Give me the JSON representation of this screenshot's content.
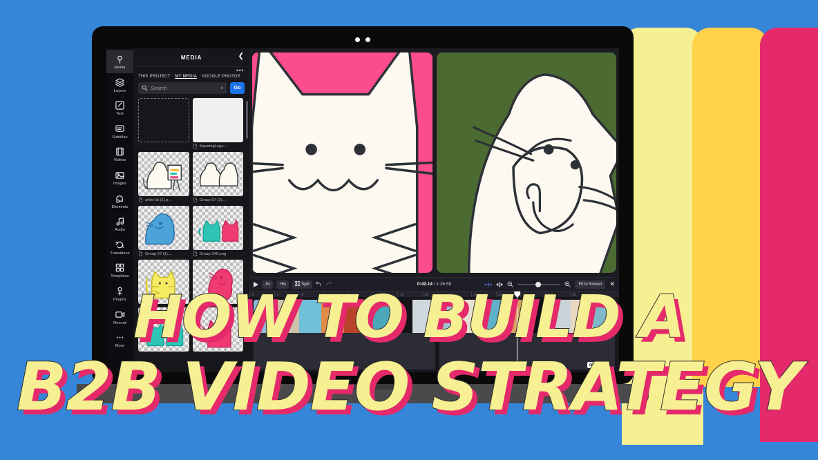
{
  "background": {
    "base_color": "#3585d8",
    "bars": [
      {
        "name": "bar-yellow-light",
        "color": "#f6f093"
      },
      {
        "name": "bar-yellow-gold",
        "color": "#ffd24a"
      },
      {
        "name": "bar-pink",
        "color": "#e42a6b"
      }
    ]
  },
  "overlay_title": {
    "line1": "HOW TO BUILD A",
    "line2": "B2B VIDEO STRATEGY",
    "fill_color": "#f6f093",
    "shadow_color": "#e42a6b",
    "stroke_color": "#2a2a2a"
  },
  "app": {
    "rail": {
      "items": [
        {
          "label": "Media",
          "icon": "media-icon",
          "active": true
        },
        {
          "label": "Layers",
          "icon": "layers-icon",
          "active": false
        },
        {
          "label": "Text",
          "icon": "text-icon",
          "active": false
        },
        {
          "label": "Subtitles",
          "icon": "subtitles-icon",
          "active": false
        },
        {
          "label": "Videos",
          "icon": "videos-icon",
          "active": false
        },
        {
          "label": "Images",
          "icon": "images-icon",
          "active": false
        },
        {
          "label": "Elements",
          "icon": "elements-icon",
          "active": false
        },
        {
          "label": "Audio",
          "icon": "audio-icon",
          "active": false
        },
        {
          "label": "Transitions",
          "icon": "transitions-icon",
          "active": false
        },
        {
          "label": "Templates",
          "icon": "templates-icon",
          "active": false
        },
        {
          "label": "Plugins",
          "icon": "plugins-icon",
          "active": false
        },
        {
          "label": "Record",
          "icon": "record-icon",
          "active": false
        },
        {
          "label": "More",
          "icon": "more-icon",
          "active": false
        }
      ]
    },
    "media_panel": {
      "title": "MEDIA",
      "collapse_icon": "chevron-left-icon",
      "overflow_icon": "more-horizontal-icon",
      "tabs": [
        {
          "label": "THIS PROJECT",
          "active": false
        },
        {
          "label": "MY MEDIA",
          "active": true
        },
        {
          "label": "GOOGLE PHOTOS",
          "active": false
        }
      ],
      "search": {
        "placeholder": "Search",
        "value": "",
        "clear_label": "×",
        "go_label": "Go",
        "go_color": "#1a73e8"
      },
      "files": [
        {
          "name": "",
          "kind": "upload"
        },
        {
          "name": "KapwingLogo...",
          "kind": "logo"
        },
        {
          "name": "artist kit (1).p...",
          "kind": "cat-easel"
        },
        {
          "name": "Group 67 (2)....",
          "kind": "cats-pair"
        },
        {
          "name": "Group 67 (1)....",
          "kind": "cat-blue"
        },
        {
          "name": "Group 349.png",
          "kind": "cats-teal-pink"
        },
        {
          "name": "",
          "kind": "cat-yellow"
        },
        {
          "name": "",
          "kind": "cat-pink"
        },
        {
          "name": "",
          "kind": "cats-teal-two"
        },
        {
          "name": "",
          "kind": "cat-pink-sit"
        }
      ]
    },
    "canvas": {
      "tiles": [
        {
          "name": "cat-front-pink",
          "background": "#fb4d8c",
          "line_color": "#2d3137",
          "body_color": "#fdf9f0"
        },
        {
          "name": "cat-side-green",
          "background": "#4b6b33",
          "line_color": "#2d3137",
          "body_color": "#fdf9f0"
        }
      ]
    },
    "timeline": {
      "toolbar": {
        "play_icon": "play-icon",
        "back5_label": "-5s",
        "fwd5_label": "+5s",
        "split_label": "Split",
        "split_icon": "split-icon",
        "undo_icon": "undo-icon",
        "redo_icon": "redo-icon",
        "current_time": "0:42.14",
        "separator": "/",
        "total_time": "1:26.59",
        "snap_icon": "snap-center-icon",
        "align_icon": "align-horizontal-icon",
        "zoom_out_icon": "zoom-out-icon",
        "zoom_in_icon": "zoom-in-icon",
        "fit_label": "Fit to Screen",
        "close_icon": "close-icon"
      },
      "ruler_ticks": [
        ":0",
        ":4",
        ":8",
        ":12",
        ":16",
        ":20",
        ":24",
        ":28",
        ":32",
        ":36",
        ":40",
        ":44",
        ":48",
        ":52",
        ":56"
      ],
      "playhead_position_pct": 72.4,
      "time_badge": "00:43:01",
      "clips": [
        {
          "name": "clip-a"
        },
        {
          "name": "clip-b"
        }
      ]
    }
  }
}
